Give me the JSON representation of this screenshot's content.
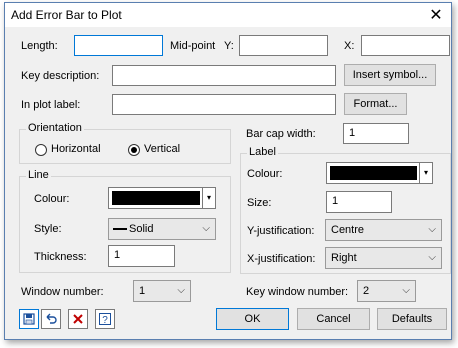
{
  "window": {
    "title": "Add Error Bar to Plot",
    "close_glyph": "✕"
  },
  "length": {
    "label": "Length:",
    "value": ""
  },
  "midpoint": {
    "label": "Mid-point",
    "y_label": "Y:",
    "y_value": "",
    "x_label": "X:",
    "x_value": ""
  },
  "key_description": {
    "label": "Key description:",
    "value": "",
    "button": "Insert symbol..."
  },
  "in_plot_label": {
    "label": "In plot label:",
    "value": "",
    "button": "Format..."
  },
  "orientation": {
    "title": "Orientation",
    "options": [
      {
        "label": "Horizontal",
        "selected": false
      },
      {
        "label": "Vertical",
        "selected": true
      }
    ]
  },
  "bar_cap": {
    "label": "Bar cap width:",
    "value": "1"
  },
  "line": {
    "title": "Line",
    "colour_label": "Colour:",
    "colour": "#000000",
    "style_label": "Style:",
    "style_value": "Solid",
    "thickness_label": "Thickness:",
    "thickness_value": "1"
  },
  "label_group": {
    "title": "Label",
    "colour_label": "Colour:",
    "colour": "#000000",
    "size_label": "Size:",
    "size_value": "1",
    "yjust_label": "Y-justification:",
    "yjust_value": "Centre",
    "xjust_label": "X-justification:",
    "xjust_value": "Right"
  },
  "window_number": {
    "label": "Window number:",
    "value": "1"
  },
  "key_window_number": {
    "label": "Key window number:",
    "value": "2"
  },
  "footer": {
    "ok": "OK",
    "cancel": "Cancel",
    "defaults": "Defaults"
  },
  "icons": [
    "save-options-icon",
    "restore-icon",
    "clear-icon",
    "help-icon"
  ]
}
